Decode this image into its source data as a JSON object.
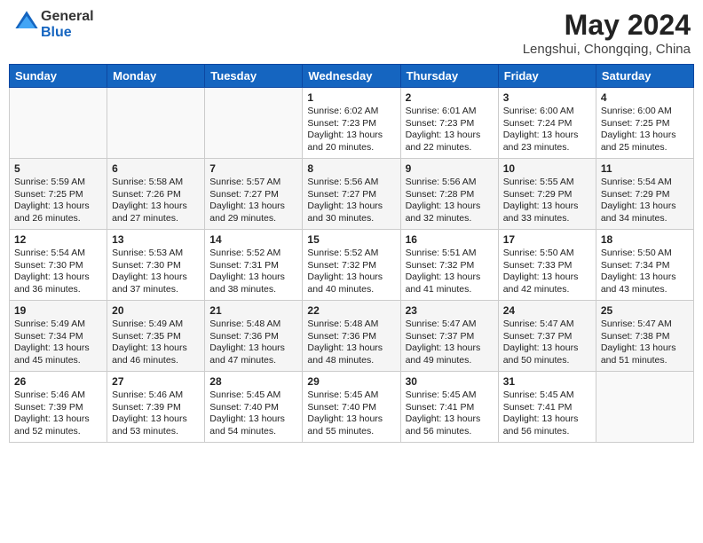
{
  "header": {
    "logo_line1": "General",
    "logo_line2": "Blue",
    "month_year": "May 2024",
    "location": "Lengshui, Chongqing, China"
  },
  "days_of_week": [
    "Sunday",
    "Monday",
    "Tuesday",
    "Wednesday",
    "Thursday",
    "Friday",
    "Saturday"
  ],
  "weeks": [
    {
      "days": [
        {
          "num": "",
          "content": ""
        },
        {
          "num": "",
          "content": ""
        },
        {
          "num": "",
          "content": ""
        },
        {
          "num": "1",
          "content": "Sunrise: 6:02 AM\nSunset: 7:23 PM\nDaylight: 13 hours\nand 20 minutes."
        },
        {
          "num": "2",
          "content": "Sunrise: 6:01 AM\nSunset: 7:23 PM\nDaylight: 13 hours\nand 22 minutes."
        },
        {
          "num": "3",
          "content": "Sunrise: 6:00 AM\nSunset: 7:24 PM\nDaylight: 13 hours\nand 23 minutes."
        },
        {
          "num": "4",
          "content": "Sunrise: 6:00 AM\nSunset: 7:25 PM\nDaylight: 13 hours\nand 25 minutes."
        }
      ]
    },
    {
      "days": [
        {
          "num": "5",
          "content": "Sunrise: 5:59 AM\nSunset: 7:25 PM\nDaylight: 13 hours\nand 26 minutes."
        },
        {
          "num": "6",
          "content": "Sunrise: 5:58 AM\nSunset: 7:26 PM\nDaylight: 13 hours\nand 27 minutes."
        },
        {
          "num": "7",
          "content": "Sunrise: 5:57 AM\nSunset: 7:27 PM\nDaylight: 13 hours\nand 29 minutes."
        },
        {
          "num": "8",
          "content": "Sunrise: 5:56 AM\nSunset: 7:27 PM\nDaylight: 13 hours\nand 30 minutes."
        },
        {
          "num": "9",
          "content": "Sunrise: 5:56 AM\nSunset: 7:28 PM\nDaylight: 13 hours\nand 32 minutes."
        },
        {
          "num": "10",
          "content": "Sunrise: 5:55 AM\nSunset: 7:29 PM\nDaylight: 13 hours\nand 33 minutes."
        },
        {
          "num": "11",
          "content": "Sunrise: 5:54 AM\nSunset: 7:29 PM\nDaylight: 13 hours\nand 34 minutes."
        }
      ]
    },
    {
      "days": [
        {
          "num": "12",
          "content": "Sunrise: 5:54 AM\nSunset: 7:30 PM\nDaylight: 13 hours\nand 36 minutes."
        },
        {
          "num": "13",
          "content": "Sunrise: 5:53 AM\nSunset: 7:30 PM\nDaylight: 13 hours\nand 37 minutes."
        },
        {
          "num": "14",
          "content": "Sunrise: 5:52 AM\nSunset: 7:31 PM\nDaylight: 13 hours\nand 38 minutes."
        },
        {
          "num": "15",
          "content": "Sunrise: 5:52 AM\nSunset: 7:32 PM\nDaylight: 13 hours\nand 40 minutes."
        },
        {
          "num": "16",
          "content": "Sunrise: 5:51 AM\nSunset: 7:32 PM\nDaylight: 13 hours\nand 41 minutes."
        },
        {
          "num": "17",
          "content": "Sunrise: 5:50 AM\nSunset: 7:33 PM\nDaylight: 13 hours\nand 42 minutes."
        },
        {
          "num": "18",
          "content": "Sunrise: 5:50 AM\nSunset: 7:34 PM\nDaylight: 13 hours\nand 43 minutes."
        }
      ]
    },
    {
      "days": [
        {
          "num": "19",
          "content": "Sunrise: 5:49 AM\nSunset: 7:34 PM\nDaylight: 13 hours\nand 45 minutes."
        },
        {
          "num": "20",
          "content": "Sunrise: 5:49 AM\nSunset: 7:35 PM\nDaylight: 13 hours\nand 46 minutes."
        },
        {
          "num": "21",
          "content": "Sunrise: 5:48 AM\nSunset: 7:36 PM\nDaylight: 13 hours\nand 47 minutes."
        },
        {
          "num": "22",
          "content": "Sunrise: 5:48 AM\nSunset: 7:36 PM\nDaylight: 13 hours\nand 48 minutes."
        },
        {
          "num": "23",
          "content": "Sunrise: 5:47 AM\nSunset: 7:37 PM\nDaylight: 13 hours\nand 49 minutes."
        },
        {
          "num": "24",
          "content": "Sunrise: 5:47 AM\nSunset: 7:37 PM\nDaylight: 13 hours\nand 50 minutes."
        },
        {
          "num": "25",
          "content": "Sunrise: 5:47 AM\nSunset: 7:38 PM\nDaylight: 13 hours\nand 51 minutes."
        }
      ]
    },
    {
      "days": [
        {
          "num": "26",
          "content": "Sunrise: 5:46 AM\nSunset: 7:39 PM\nDaylight: 13 hours\nand 52 minutes."
        },
        {
          "num": "27",
          "content": "Sunrise: 5:46 AM\nSunset: 7:39 PM\nDaylight: 13 hours\nand 53 minutes."
        },
        {
          "num": "28",
          "content": "Sunrise: 5:45 AM\nSunset: 7:40 PM\nDaylight: 13 hours\nand 54 minutes."
        },
        {
          "num": "29",
          "content": "Sunrise: 5:45 AM\nSunset: 7:40 PM\nDaylight: 13 hours\nand 55 minutes."
        },
        {
          "num": "30",
          "content": "Sunrise: 5:45 AM\nSunset: 7:41 PM\nDaylight: 13 hours\nand 56 minutes."
        },
        {
          "num": "31",
          "content": "Sunrise: 5:45 AM\nSunset: 7:41 PM\nDaylight: 13 hours\nand 56 minutes."
        },
        {
          "num": "",
          "content": ""
        }
      ]
    }
  ]
}
